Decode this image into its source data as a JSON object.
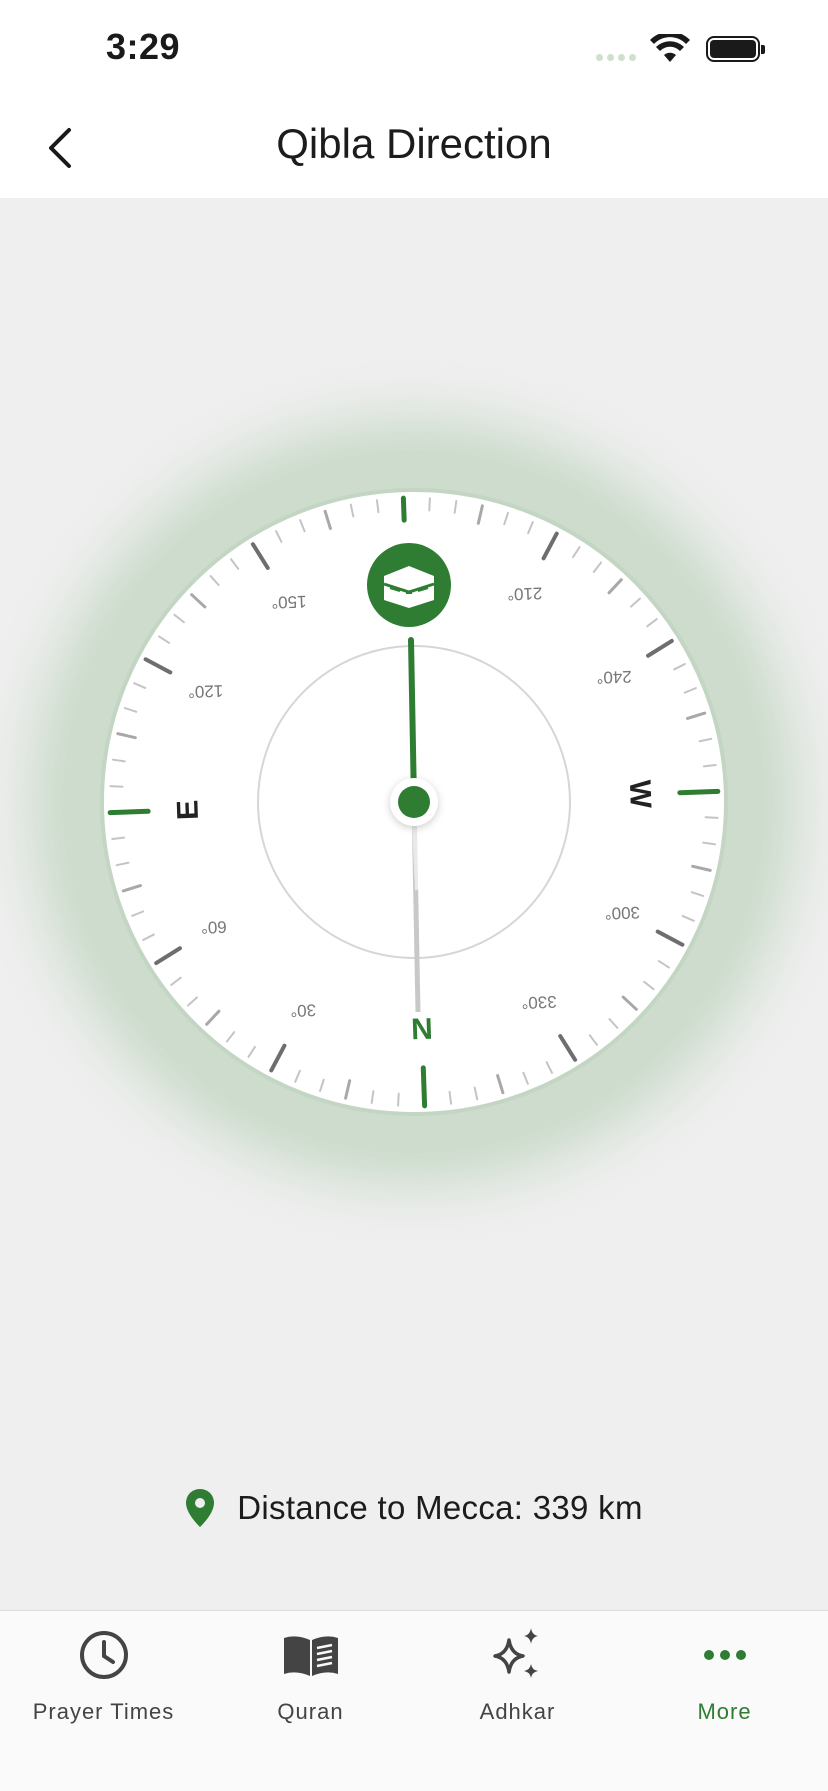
{
  "status_bar": {
    "time": "3:29"
  },
  "app_bar": {
    "title": "Qibla Direction"
  },
  "compass": {
    "heading_note_north_deg": 180,
    "cardinals": [
      "N",
      "E",
      "W"
    ],
    "degree_labels": [
      "30°",
      "60°",
      "120°",
      "150°",
      "210°",
      "240°",
      "300°",
      "330°"
    ],
    "accent_color": "#2e7d32",
    "kaaba_icon": "kaaba-icon"
  },
  "distance": {
    "text": "Distance to Mecca: 339 km",
    "icon": "location-pin-icon"
  },
  "bottom_nav": {
    "items": [
      {
        "label": "Prayer Times",
        "icon": "clock-icon"
      },
      {
        "label": "Quran",
        "icon": "book-icon"
      },
      {
        "label": "Adhkar",
        "icon": "sparkles-icon"
      },
      {
        "label": "More",
        "icon": "more-dots-icon",
        "active": true
      }
    ]
  }
}
